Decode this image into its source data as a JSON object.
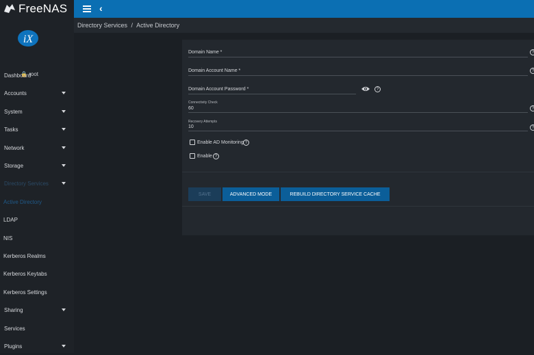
{
  "app": {
    "brand": "FreeNAS"
  },
  "user": {
    "name": "root"
  },
  "sidebar": {
    "items": [
      {
        "label": "Dashboard",
        "caret": false
      },
      {
        "label": "Accounts",
        "caret": true
      },
      {
        "label": "System",
        "caret": true
      },
      {
        "label": "Tasks",
        "caret": true
      },
      {
        "label": "Network",
        "caret": true
      },
      {
        "label": "Storage",
        "caret": true
      },
      {
        "label": "Directory Services",
        "caret": true
      },
      {
        "label": "Active Directory",
        "caret": false
      },
      {
        "label": "LDAP",
        "caret": false
      },
      {
        "label": "NIS",
        "caret": false
      },
      {
        "label": "Kerberos Realms",
        "caret": false
      },
      {
        "label": "Kerberos Keytabs",
        "caret": false
      },
      {
        "label": "Kerberos Settings",
        "caret": false
      },
      {
        "label": "Sharing",
        "caret": true
      },
      {
        "label": "Services",
        "caret": false
      },
      {
        "label": "Plugins",
        "caret": true
      }
    ]
  },
  "breadcrumb": {
    "parent": "Directory Services",
    "separator": "/",
    "current": "Active Directory"
  },
  "form": {
    "domain_name_label": "Domain Name *",
    "domain_account_name_label": "Domain Account Name *",
    "domain_account_password_label": "Domain Account Password *",
    "connectivity_check_label": "Connectivity Check",
    "connectivity_check_value": "60",
    "recovery_attempts_label": "Recovery Attempts",
    "recovery_attempts_value": "10",
    "enable_ad_monitoring_label": "Enable AD Monitoring",
    "enable_label": "Enable",
    "help_glyph": "?"
  },
  "actions": {
    "save": "SAVE",
    "advanced_mode": "ADVANCED MODE",
    "rebuild_cache": "REBUILD DIRECTORY SERVICE CACHE"
  },
  "colors": {
    "topbar": "#0b6fb3",
    "sidebar": "#1e2227",
    "card": "#23282e",
    "accent": "#0b5e99"
  }
}
